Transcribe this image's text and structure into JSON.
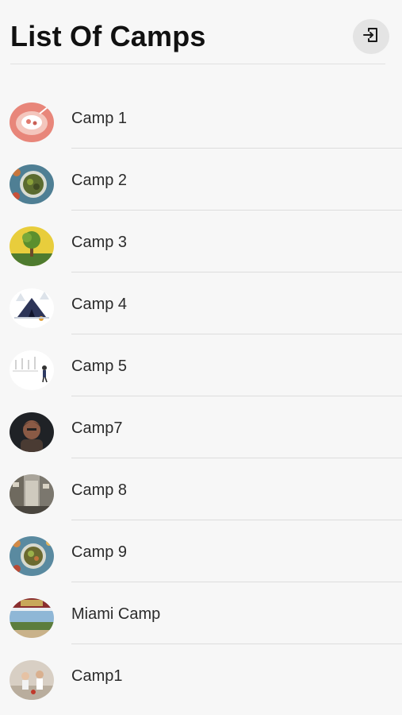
{
  "header": {
    "title": "List Of Camps",
    "logout_icon": "logout-icon"
  },
  "camps": [
    {
      "name": "Camp 1",
      "avatar": "dessert-photo"
    },
    {
      "name": "Camp 2",
      "avatar": "salad-bowl-photo"
    },
    {
      "name": "Camp 3",
      "avatar": "tree-illustration"
    },
    {
      "name": "Camp 4",
      "avatar": "tent-illustration"
    },
    {
      "name": "Camp 5",
      "avatar": "sketch-illustration"
    },
    {
      "name": "Camp7",
      "avatar": "portrait-photo"
    },
    {
      "name": "Camp 8",
      "avatar": "street-photo"
    },
    {
      "name": "Camp 9",
      "avatar": "food-table-photo"
    },
    {
      "name": "Miami Camp",
      "avatar": "miami-sign-photo"
    },
    {
      "name": "Camp1",
      "avatar": "kids-photo"
    }
  ]
}
